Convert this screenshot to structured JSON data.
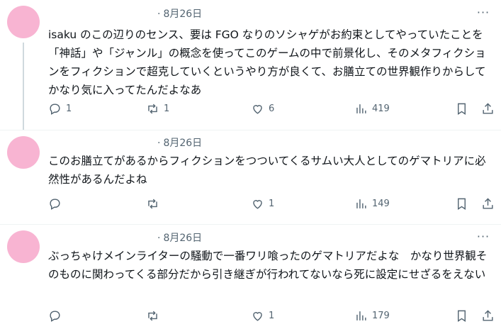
{
  "posts": [
    {
      "date": "8月26日",
      "more": "···",
      "text": "isaku のこの辺りのセンス、要は FGO なりのソシャゲがお約束としてやっていたことを「神話」や「ジャンル」の概念を使ってこのゲームの中で前景化し、そのメタフィクションをフィクションで超克していくというやり方が良くて、お膳立ての世界観作りからしてかなり気に入ってたんだよなあ",
      "replies": "1",
      "reposts": "1",
      "likes": "6",
      "views": "419"
    },
    {
      "date": "8月26日",
      "more": "···",
      "text": "このお膳立てがあるからフィクションをつついてくるサムい大人としてのゲマトリアに必然性があるんだよね",
      "replies": "",
      "reposts": "",
      "likes": "1",
      "views": "149"
    },
    {
      "date": "8月26日",
      "more": "···",
      "text": "ぶっちゃけメインライターの騒動で一番ワリ喰ったのゲマトリアだよな　かなり世界観そのものに関わってくる部分だから引き継ぎが行われてないなら死に設定にせざるをえない",
      "replies": "",
      "reposts": "",
      "likes": "1",
      "views": "179"
    }
  ],
  "colors": {
    "avatar": "#f8b4d2",
    "text": "#0f1419",
    "secondary": "#536471"
  }
}
